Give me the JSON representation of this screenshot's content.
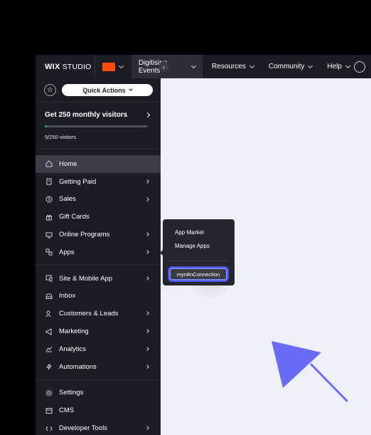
{
  "topbar": {
    "logo_wix": "WIX",
    "logo_studio": "STUDIO",
    "site_color": "#ff4d11",
    "site_name": "Digitising Events",
    "nav": [
      "Resources",
      "Community",
      "Help"
    ]
  },
  "sidebar": {
    "quick_actions": "Quick Actions",
    "visitors_title": "Get 250 monthly visitors",
    "visitors_count": "5/250 visitors",
    "visitors_progress": 0.02,
    "items": [
      {
        "label": "Home",
        "icon": "home-icon",
        "active": true,
        "chevron": false
      },
      {
        "label": "Getting Paid",
        "icon": "receipt-icon",
        "chevron": true
      },
      {
        "label": "Sales",
        "icon": "dollar-icon",
        "chevron": true
      },
      {
        "label": "Gift Cards",
        "icon": "gift-icon",
        "chevron": false
      },
      {
        "label": "Online Programs",
        "icon": "monitor-icon",
        "chevron": true
      },
      {
        "label": "Apps",
        "icon": "apps-icon",
        "chevron": true
      },
      {
        "label": "Site & Mobile App",
        "icon": "devices-icon",
        "chevron": true
      },
      {
        "label": "Inbox",
        "icon": "inbox-icon",
        "chevron": false
      },
      {
        "label": "Customers & Leads",
        "icon": "people-icon",
        "chevron": true
      },
      {
        "label": "Marketing",
        "icon": "megaphone-icon",
        "chevron": true
      },
      {
        "label": "Analytics",
        "icon": "chart-icon",
        "chevron": true
      },
      {
        "label": "Automations",
        "icon": "bolt-icon",
        "chevron": true
      },
      {
        "label": "Settings",
        "icon": "gear-icon",
        "chevron": false
      },
      {
        "label": "CMS",
        "icon": "database-icon",
        "chevron": false
      },
      {
        "label": "Developer Tools",
        "icon": "code-icon",
        "chevron": true
      }
    ]
  },
  "flyout": {
    "app_market": "App Market",
    "manage_apps": "Manage Apps",
    "connection": "myn8nConnection"
  },
  "colors": {
    "accent": "#7b80ff",
    "arrow": "#6b6cf6",
    "progress": "#3fa37a"
  }
}
